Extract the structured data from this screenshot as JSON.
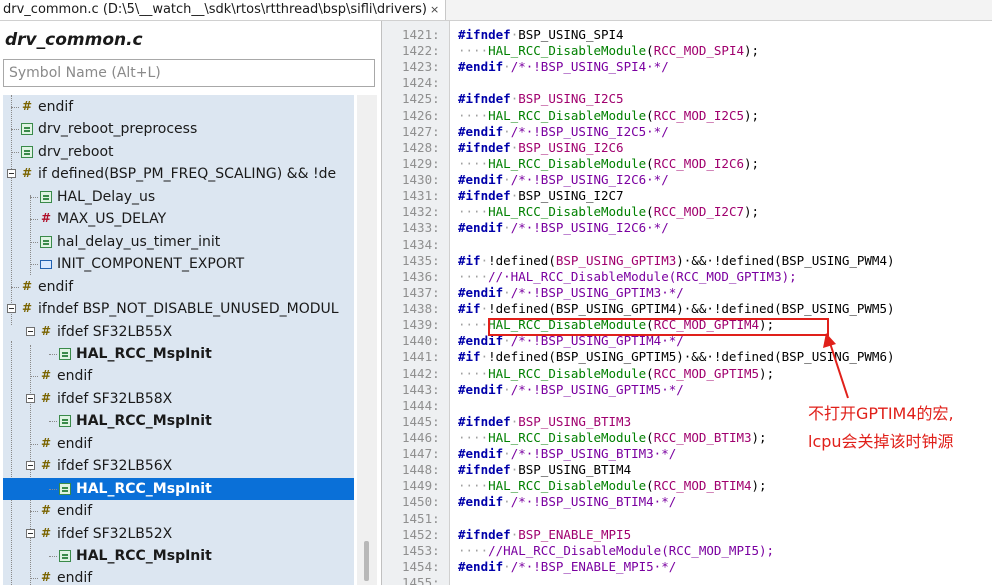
{
  "tab": {
    "title": "drv_common.c (D:\\5\\__watch__\\sdk\\rtos\\rtthread\\bsp\\sifli\\drivers)",
    "close": "×"
  },
  "left": {
    "file_title": "drv_common.c",
    "search_placeholder": "Symbol Name (Alt+L)",
    "rows": [
      {
        "label": "endif"
      },
      {
        "label": "drv_reboot_preprocess"
      },
      {
        "label": "drv_reboot"
      },
      {
        "label": "if defined(BSP_PM_FREQ_SCALING) && !de"
      },
      {
        "label": "HAL_Delay_us"
      },
      {
        "label": "MAX_US_DELAY"
      },
      {
        "label": "hal_delay_us_timer_init"
      },
      {
        "label": "INIT_COMPONENT_EXPORT"
      },
      {
        "label": "endif"
      },
      {
        "label": "ifndef BSP_NOT_DISABLE_UNUSED_MODUL"
      },
      {
        "label": "ifdef SF32LB55X"
      },
      {
        "label": "HAL_RCC_MspInit"
      },
      {
        "label": "endif"
      },
      {
        "label": "ifdef SF32LB58X"
      },
      {
        "label": "HAL_RCC_MspInit"
      },
      {
        "label": "endif"
      },
      {
        "label": "ifdef SF32LB56X"
      },
      {
        "label": "HAL_RCC_MspInit"
      },
      {
        "label": "endif"
      },
      {
        "label": "ifdef SF32LB52X"
      },
      {
        "label": "HAL_RCC_MspInit"
      },
      {
        "label": "endif"
      }
    ]
  },
  "editor": {
    "line_numbers": [
      "1421:",
      "1422:",
      "1423:",
      "1424:",
      "1425:",
      "1426:",
      "1427:",
      "1428:",
      "1429:",
      "1430:",
      "1431:",
      "1432:",
      "1433:",
      "1434:",
      "1435:",
      "1436:",
      "1437:",
      "1438:",
      "1439:",
      "1440:",
      "1441:",
      "1442:",
      "1443:",
      "1444:",
      "1445:",
      "1446:",
      "1447:",
      "1448:",
      "1449:",
      "1450:",
      "1451:",
      "1452:",
      "1453:",
      "1454:",
      "1455:"
    ],
    "lines": [
      [
        [
          "kw",
          "#ifndef"
        ],
        [
          "dot",
          "·"
        ],
        [
          "",
          "BSP_USING_SPI4"
        ]
      ],
      [
        [
          "dot",
          "····"
        ],
        [
          "fnc",
          "HAL_RCC_DisableModule"
        ],
        [
          "",
          "("
        ],
        [
          "mac",
          "RCC_MOD_SPI4"
        ],
        [
          "",
          "); "
        ]
      ],
      [
        [
          "kw",
          "#endif"
        ],
        [
          "dot",
          "·"
        ],
        [
          "cm",
          "/*·!BSP_USING_SPI4·*/"
        ]
      ],
      [
        [
          "",
          ""
        ]
      ],
      [
        [
          "kw",
          "#ifndef"
        ],
        [
          "dot",
          "·"
        ],
        [
          "mac",
          "BSP_USING_I2C5"
        ]
      ],
      [
        [
          "dot",
          "····"
        ],
        [
          "fnc",
          "HAL_RCC_DisableModule"
        ],
        [
          "",
          "("
        ],
        [
          "mac",
          "RCC_MOD_I2C5"
        ],
        [
          "",
          "); "
        ]
      ],
      [
        [
          "kw",
          "#endif"
        ],
        [
          "dot",
          "·"
        ],
        [
          "cm",
          "/*·!BSP_USING_I2C5·*/"
        ]
      ],
      [
        [
          "kw",
          "#ifndef"
        ],
        [
          "dot",
          "·"
        ],
        [
          "mac",
          "BSP_USING_I2C6"
        ]
      ],
      [
        [
          "dot",
          "····"
        ],
        [
          "fnc",
          "HAL_RCC_DisableModule"
        ],
        [
          "",
          "("
        ],
        [
          "mac",
          "RCC_MOD_I2C6"
        ],
        [
          "",
          "); "
        ]
      ],
      [
        [
          "kw",
          "#endif"
        ],
        [
          "dot",
          "·"
        ],
        [
          "cm",
          "/*·!BSP_USING_I2C6·*/"
        ]
      ],
      [
        [
          "kw",
          "#ifndef"
        ],
        [
          "dot",
          "·"
        ],
        [
          "",
          "BSP_USING_I2C7"
        ]
      ],
      [
        [
          "dot",
          "····"
        ],
        [
          "fnc",
          "HAL_RCC_DisableModule"
        ],
        [
          "",
          "("
        ],
        [
          "mac",
          "RCC_MOD_I2C7"
        ],
        [
          "",
          "); "
        ]
      ],
      [
        [
          "kw",
          "#endif"
        ],
        [
          "dot",
          "·"
        ],
        [
          "cm",
          "/*·!BSP_USING_I2C6·*/"
        ]
      ],
      [
        [
          "",
          ""
        ]
      ],
      [
        [
          "kw",
          "#if"
        ],
        [
          "dot",
          "·"
        ],
        [
          "",
          "!defined("
        ],
        [
          "mac",
          "BSP_USING_GPTIM3"
        ],
        [
          "",
          ")·&&·!defined(BSP_USING_PWM4)"
        ]
      ],
      [
        [
          "dot",
          "····"
        ],
        [
          "cm",
          "//·HAL_RCC_DisableModule(RCC_MOD_GPTIM3);"
        ]
      ],
      [
        [
          "kw",
          "#endif"
        ],
        [
          "dot",
          "·"
        ],
        [
          "cm",
          "/*·!BSP_USING_GPTIM3·*/"
        ]
      ],
      [
        [
          "kw",
          "#if"
        ],
        [
          "dot",
          "·"
        ],
        [
          "",
          "!defined(BSP_USING_GPTIM4)·&&·!defined(BSP_USING_PWM5)"
        ]
      ],
      [
        [
          "dot",
          "····"
        ],
        [
          "fnc",
          "HAL_RCC_DisableModule"
        ],
        [
          "",
          "("
        ],
        [
          "mac",
          "RCC_MOD_GPTIM4"
        ],
        [
          "",
          "); "
        ]
      ],
      [
        [
          "kw",
          "#endif"
        ],
        [
          "dot",
          "·"
        ],
        [
          "cm",
          "/*·!BSP_USING_GPTIM4·*/"
        ]
      ],
      [
        [
          "kw",
          "#if"
        ],
        [
          "dot",
          "·"
        ],
        [
          "",
          "!defined(BSP_USING_GPTIM5)·&&·!defined(BSP_USING_PWM6)"
        ]
      ],
      [
        [
          "dot",
          "····"
        ],
        [
          "fnc",
          "HAL_RCC_DisableModule"
        ],
        [
          "",
          "("
        ],
        [
          "mac",
          "RCC_MOD_GPTIM5"
        ],
        [
          "",
          "); "
        ]
      ],
      [
        [
          "kw",
          "#endif"
        ],
        [
          "dot",
          "·"
        ],
        [
          "cm",
          "/*·!BSP_USING_GPTIM5·*/"
        ]
      ],
      [
        [
          "",
          ""
        ]
      ],
      [
        [
          "kw",
          "#ifndef"
        ],
        [
          "dot",
          "·"
        ],
        [
          "mac",
          "BSP_USING_BTIM3"
        ]
      ],
      [
        [
          "dot",
          "····"
        ],
        [
          "fnc",
          "HAL_RCC_DisableModule"
        ],
        [
          "",
          "("
        ],
        [
          "mac",
          "RCC_MOD_BTIM3"
        ],
        [
          "",
          ");"
        ]
      ],
      [
        [
          "kw",
          "#endif"
        ],
        [
          "dot",
          "·"
        ],
        [
          "cm",
          "/*·!BSP_USING_BTIM3·*/"
        ]
      ],
      [
        [
          "kw",
          "#ifndef"
        ],
        [
          "dot",
          "·"
        ],
        [
          "",
          "BSP_USING_BTIM4"
        ]
      ],
      [
        [
          "dot",
          "····"
        ],
        [
          "fnc",
          "HAL_RCC_DisableModule"
        ],
        [
          "",
          "("
        ],
        [
          "mac",
          "RCC_MOD_BTIM4"
        ],
        [
          "",
          "); "
        ]
      ],
      [
        [
          "kw",
          "#endif"
        ],
        [
          "dot",
          "·"
        ],
        [
          "cm",
          "/*·!BSP_USING_BTIM4·*/"
        ]
      ],
      [
        [
          "",
          ""
        ]
      ],
      [
        [
          "kw",
          "#ifndef"
        ],
        [
          "dot",
          "·"
        ],
        [
          "mac",
          "BSP_ENABLE_MPI5"
        ]
      ],
      [
        [
          "dot",
          "····"
        ],
        [
          "cm",
          "//HAL_RCC_DisableModule(RCC_MOD_MPI5);"
        ]
      ],
      [
        [
          "kw",
          "#endif"
        ],
        [
          "dot",
          "·"
        ],
        [
          "cm",
          "/*·!BSP_ENABLE_MPI5·*/"
        ]
      ],
      [
        [
          "",
          ""
        ]
      ]
    ]
  },
  "annotation": {
    "line1": "不打开GPTIM4的宏,",
    "line2": "lcpu会关掉该时钟源",
    "color": "#e0201a"
  }
}
